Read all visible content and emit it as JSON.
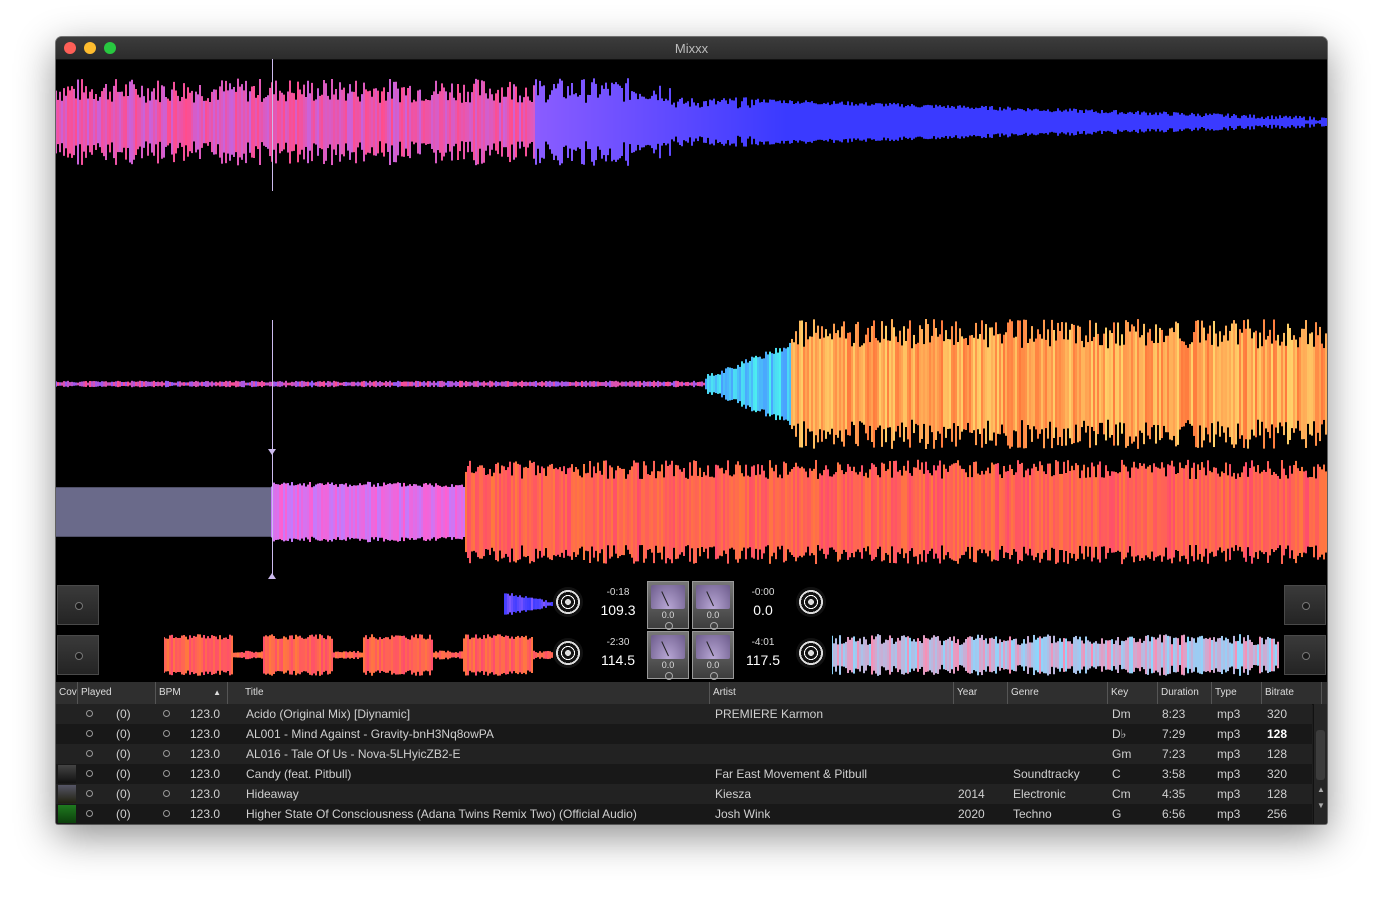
{
  "window": {
    "title": "Mixxx"
  },
  "decks": [
    {
      "time": "-0:18",
      "bpm": "109.3",
      "vu_value": "0.0"
    },
    {
      "time": "-0:00",
      "bpm": "0.0",
      "vu_value": "0.0"
    },
    {
      "time": "-2:30",
      "bpm": "114.5",
      "vu_value": "0.0"
    },
    {
      "time": "-4:01",
      "bpm": "117.5",
      "vu_value": "0.0"
    }
  ],
  "library": {
    "columns": [
      "Cov",
      "Played",
      "BPM",
      "Title",
      "Artist",
      "Year",
      "Genre",
      "Key",
      "Duration",
      "Type",
      "Bitrate"
    ],
    "rows": [
      {
        "played": "(0)",
        "bpm": "123.0",
        "title": "Acido (Original Mix) [Diynamic]",
        "artist": "PREMIERE Karmon",
        "year": "",
        "genre": "",
        "key": "Dm",
        "duration": "8:23",
        "type": "mp3",
        "bitrate": "320",
        "cover": ""
      },
      {
        "played": "(0)",
        "bpm": "123.0",
        "title": "AL001 -  Mind Against - Gravity-bnH3Nq8owPA",
        "artist": "",
        "year": "",
        "genre": "",
        "key": "D♭",
        "duration": "7:29",
        "type": "mp3",
        "bitrate": "128",
        "cover": ""
      },
      {
        "played": "(0)",
        "bpm": "123.0",
        "title": "AL016 - Tale Of Us - Nova-5LHyicZB2-E",
        "artist": "",
        "year": "",
        "genre": "",
        "key": "Gm",
        "duration": "7:23",
        "type": "mp3",
        "bitrate": "128",
        "cover": ""
      },
      {
        "played": "(0)",
        "bpm": "123.0",
        "title": "Candy (feat. Pitbull)",
        "artist": "Far East Movement & Pitbull",
        "year": "",
        "genre": "Soundtracky",
        "key": "C",
        "duration": "3:58",
        "type": "mp3",
        "bitrate": "320",
        "cover": "dark"
      },
      {
        "played": "(0)",
        "bpm": "123.0",
        "title": "Hideaway",
        "artist": "Kiesza",
        "year": "2014",
        "genre": "Electronic",
        "key": "Cm",
        "duration": "4:35",
        "type": "mp3",
        "bitrate": "128",
        "cover": "portrait"
      },
      {
        "played": "(0)",
        "bpm": "123.0",
        "title": "Higher State Of Consciousness (Adana Twins Remix Two) (Official Audio)",
        "artist": "Josh Wink",
        "year": "2020",
        "genre": "Techno",
        "key": "G",
        "duration": "6:56",
        "type": "mp3",
        "bitrate": "256",
        "cover": "green"
      }
    ],
    "selected_bitrate_row": 1,
    "sort_indicator": "▲"
  },
  "colors": {
    "waveform_pink": "#ff4d8d",
    "waveform_blue": "#3a3aff",
    "waveform_orange": "#ff7a3d",
    "waveform_yellow": "#ffd36b",
    "waveform_cyan": "#4cf0f0",
    "playhead": "#ccbbee"
  }
}
